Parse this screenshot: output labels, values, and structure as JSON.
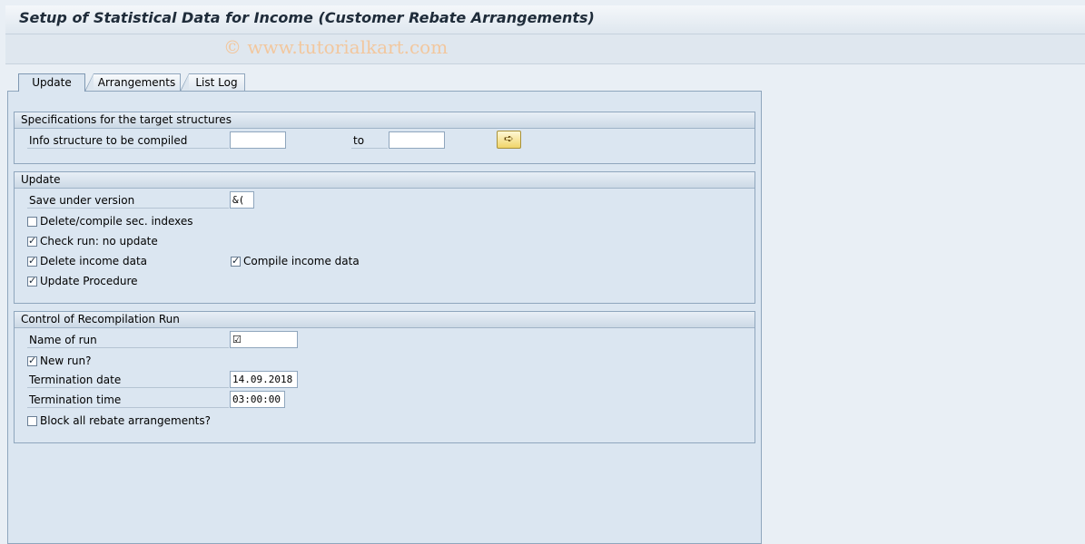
{
  "window": {
    "title": "Setup of Statistical Data for Income (Customer Rebate Arrangements)",
    "watermark": "© www.tutorialkart.com"
  },
  "tabs": [
    {
      "label": "Update",
      "active": true
    },
    {
      "label": "Arrangements",
      "active": false
    },
    {
      "label": "List Log",
      "active": false
    }
  ],
  "specs": {
    "header": "Specifications for the target structures",
    "info_structure_label": "Info structure to be compiled",
    "from_value": "",
    "to_label": "to",
    "to_value": "",
    "multi_select_icon": "arrow-right-icon"
  },
  "update": {
    "header": "Update",
    "save_version_label": "Save under version",
    "save_version_value": "&(",
    "delete_compile_sec_indexes": {
      "label": "Delete/compile sec. indexes",
      "checked": false
    },
    "check_run": {
      "label": "Check run: no update",
      "checked": true
    },
    "delete_income_data": {
      "label": "Delete income data",
      "checked": true
    },
    "compile_income_data": {
      "label": "Compile income data",
      "checked": true
    },
    "update_procedure": {
      "label": "Update Procedure",
      "checked": true
    }
  },
  "recompilation": {
    "header": "Control of Recompilation Run",
    "name_of_run_label": "Name of run",
    "name_of_run_value": "",
    "new_run": {
      "label": "New run?",
      "checked": true
    },
    "termination_date_label": "Termination date",
    "termination_date_value": "14.09.2018",
    "termination_time_label": "Termination time",
    "termination_time_value": "03:00:00",
    "block_all": {
      "label": "Block all rebate arrangements?",
      "checked": false
    }
  }
}
